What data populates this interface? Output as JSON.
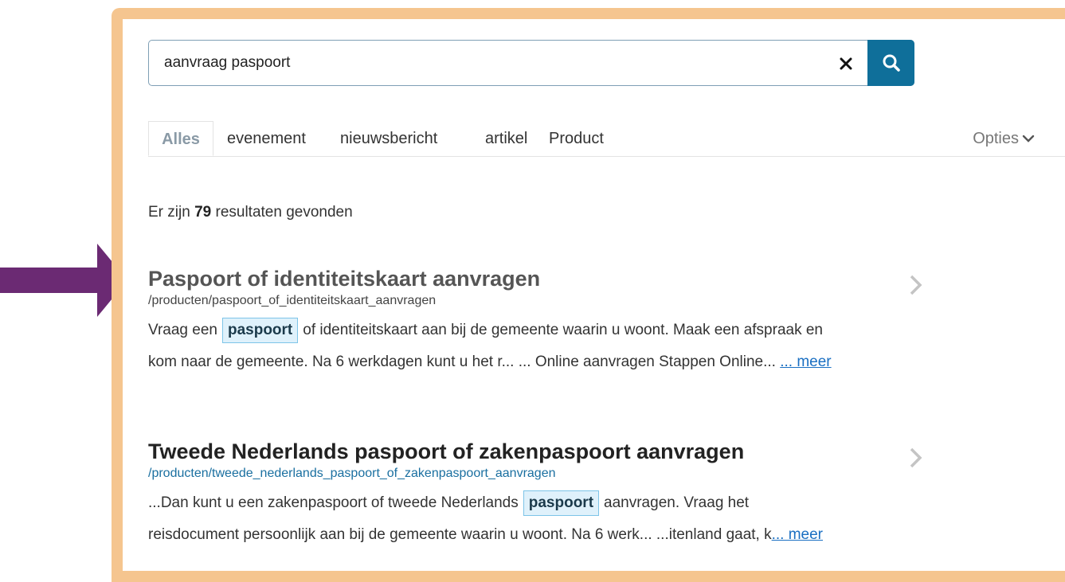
{
  "search": {
    "value": "aanvraag paspoort",
    "clear_icon": "close-icon",
    "search_icon": "search-icon"
  },
  "tabs": [
    {
      "label": "Alles",
      "active": true
    },
    {
      "label": "evenement"
    },
    {
      "label": "nieuwsbericht"
    },
    {
      "label": "artikel"
    },
    {
      "label": "Product"
    }
  ],
  "options_label": "Opties",
  "results_count": {
    "prefix": "Er zijn ",
    "count": "79",
    "suffix": " resultaten gevonden"
  },
  "results": [
    {
      "title": "Paspoort of identiteitskaart aanvragen",
      "url": "/producten/paspoort_of_identiteitskaart_aanvragen",
      "line1_before": "Vraag een",
      "highlight": "paspoort",
      "line1_after": "of identiteitskaart aan bij de gemeente waarin u woont. Maak een afspraak en",
      "line2": "kom naar de gemeente. Na 6 werkdagen kunt u het r... ... Online aanvragen Stappen Online...",
      "more": "... meer"
    },
    {
      "title": "Tweede Nederlands paspoort of zakenpaspoort aanvragen",
      "url": "/producten/tweede_nederlands_paspoort_of_zakenpaspoort_aanvragen",
      "line1_before": "...Dan kunt u een zakenpaspoort of tweede Nederlands",
      "highlight": "paspoort",
      "line1_after": "aanvragen. Vraag het",
      "line2": "reisdocument persoonlijk aan bij de gemeente waarin u woont. Na 6 werk... ...itenland gaat, k",
      "more": "... meer"
    }
  ],
  "colors": {
    "frame": "#f5c58f",
    "search_button": "#0f6f9a",
    "arrow": "#6b2a73",
    "title_first": "#555555",
    "title_second": "#222222",
    "url_first": "#444444",
    "url_second": "#1a6fa0",
    "link": "#1a6fc2"
  },
  "annotation_icon": "arrow-right-icon"
}
